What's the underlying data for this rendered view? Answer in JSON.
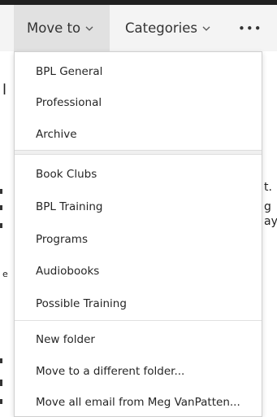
{
  "toolbar": {
    "move_to_label": "Move to",
    "categories_label": "Categories",
    "more_label": "•••",
    "chevron_icon": "chevron-down-icon"
  },
  "background": {
    "fragments": [
      "l",
      "t.",
      "g",
      "ay",
      "e",
      "'"
    ]
  },
  "menu": {
    "group1": [
      "BPL General",
      "Professional",
      "Archive"
    ],
    "group2": [
      "Book Clubs",
      "BPL Training",
      "Programs",
      "Audiobooks",
      "Possible Training"
    ],
    "group3": [
      "New folder",
      "Move to a different folder...",
      "Move all email from Meg VanPatten..."
    ]
  }
}
